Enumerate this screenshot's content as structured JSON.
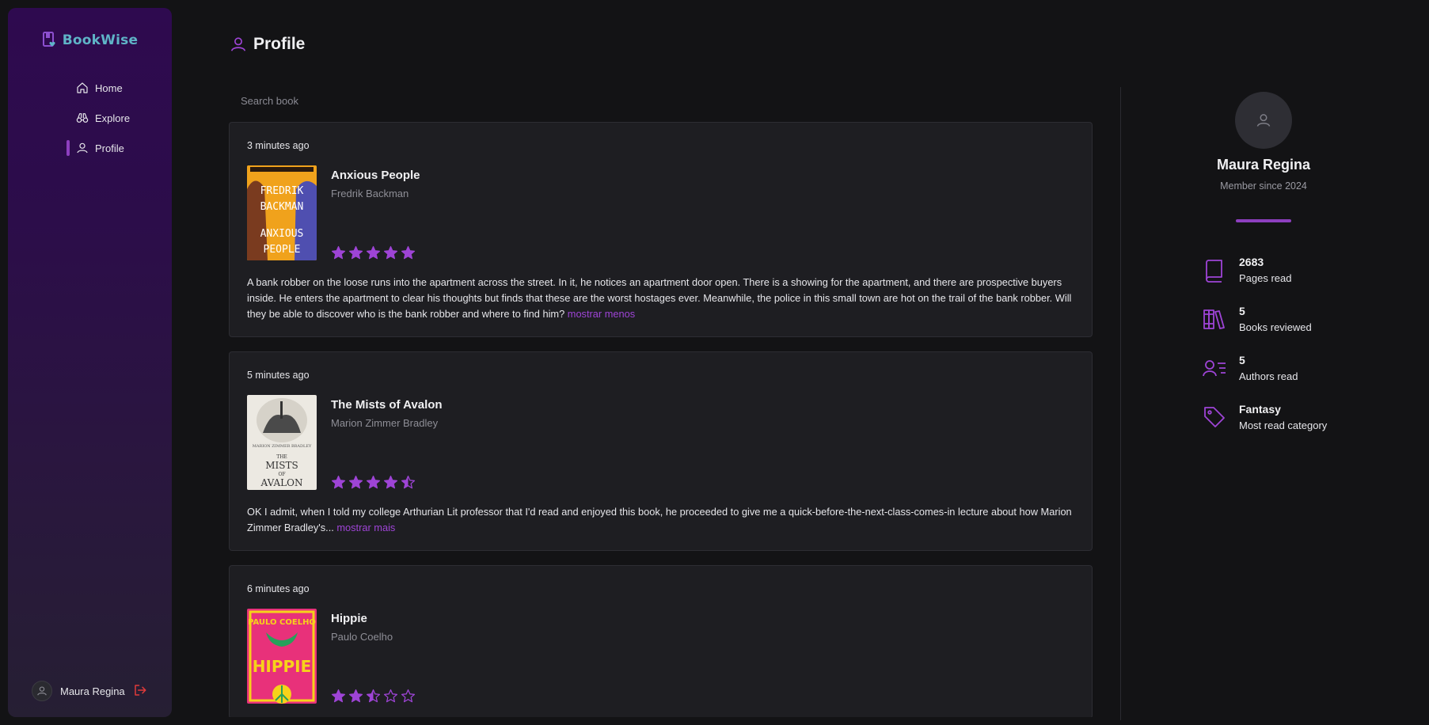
{
  "app": {
    "name": "BookWise"
  },
  "sidebar": {
    "items": [
      {
        "label": "Home",
        "icon": "home-icon"
      },
      {
        "label": "Explore",
        "icon": "binoculars-icon"
      },
      {
        "label": "Profile",
        "icon": "user-icon",
        "active": true
      }
    ],
    "user": {
      "name": "Maura Regina"
    }
  },
  "header": {
    "title": "Profile"
  },
  "search": {
    "placeholder": "Search book"
  },
  "reviews": [
    {
      "time": "3 minutes ago",
      "title": "Anxious People",
      "author": "Fredrik Backman",
      "rating": 5,
      "text": "A bank robber on the loose runs into the apartment across the street. In it, he notices an apartment door open. There is a showing for the apartment, and there are prospective buyers inside. He enters the apartment to clear his thoughts but finds that these are the worst hostages ever. Meanwhile, the police in this small town are hot on the trail of the bank robber. Will they be able to discover who is the bank robber and where to find him?",
      "toggle": "mostrar menos",
      "cover": {
        "bg": "#f0a21c",
        "lines": [
          "FREDRIK",
          "BACKMAN",
          "ANXIOUS",
          "PEOPLE"
        ]
      }
    },
    {
      "time": "5 minutes ago",
      "title": "The Mists of Avalon",
      "author": "Marion Zimmer Bradley",
      "rating": 4.5,
      "text": "OK I admit, when I told my college Arthurian Lit professor that I'd read and enjoyed this book, he proceeded to give me a quick-before-the-next-class-comes-in lecture about how Marion Zimmer Bradley's...",
      "toggle": "mostrar mais",
      "cover": {
        "bg": "#ece9e2",
        "lines": [
          "MARION ZIMMER BRADLEY",
          "THE",
          "MISTS",
          "OF",
          "AVALON"
        ]
      }
    },
    {
      "time": "6 minutes ago",
      "title": "Hippie",
      "author": "Paulo Coelho",
      "rating": 2.5,
      "text": "",
      "toggle": "",
      "cover": {
        "bg": "#e8317a",
        "lines": [
          "PAULO COELHO",
          "HIPPIE"
        ]
      }
    }
  ],
  "profile": {
    "name": "Maura Regina",
    "since": "Member since 2024",
    "stats": [
      {
        "value": "2683",
        "label": "Pages read",
        "icon": "book-icon"
      },
      {
        "value": "5",
        "label": "Books reviewed",
        "icon": "library-icon"
      },
      {
        "value": "5",
        "label": "Authors read",
        "icon": "user-list-icon"
      },
      {
        "value": "Fantasy",
        "label": "Most read category",
        "icon": "tag-icon"
      }
    ]
  },
  "colors": {
    "accent": "#8d3fbf",
    "logo": "#5fb4c7",
    "logout": "#e03a3a"
  }
}
